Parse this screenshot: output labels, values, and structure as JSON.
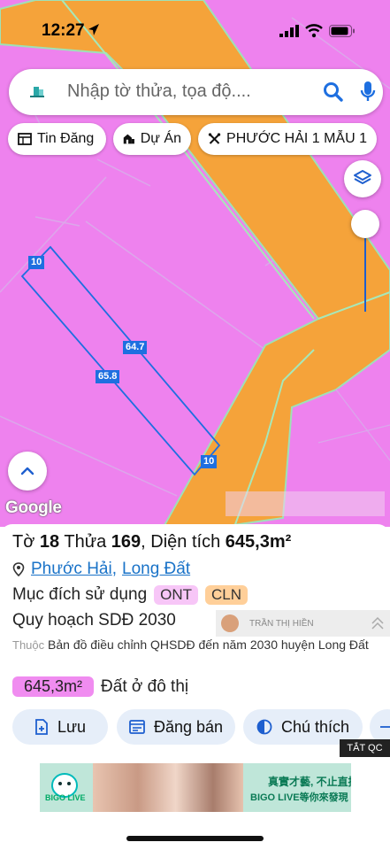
{
  "status_bar": {
    "time": "12:27"
  },
  "search": {
    "placeholder": "Nhập tờ thửa, tọa độ...."
  },
  "chips": [
    {
      "label": "Tin Đăng",
      "icon": "newspaper-icon"
    },
    {
      "label": "Dự Án",
      "icon": "buildings-icon"
    },
    {
      "label": "PHƯỚC HẢI 1 MẪU 1",
      "icon": "tools-icon"
    }
  ],
  "map": {
    "dimensions": {
      "top": "10",
      "bottom": "10",
      "right_long": "64.7",
      "left_long": "65.8"
    },
    "watermark": "Google"
  },
  "parcel": {
    "sheet_label": "Tờ",
    "sheet": "18",
    "plot_label": "Thửa",
    "plot": "169",
    "area_label": "Diện tích",
    "area": "645,3m²",
    "ward": "Phước Hải",
    "district": "Long Đất",
    "purpose_label": "Mục đích sử dụng",
    "purpose_tags": [
      "ONT",
      "CLN"
    ],
    "plan_label": "Quy hoạch SDĐ 2030",
    "desc_prefix": "Thuộc",
    "desc": "Bản đồ điều chỉnh QHSDĐ đến năm 2030 huyện Long Đất",
    "area_badge": "645,3m²",
    "land_type": "Đất ở đô thị"
  },
  "overlay": {
    "name": "TRẦN THỊ HIỀN"
  },
  "actions": [
    {
      "label": "Lưu",
      "icon": "save-doc-icon"
    },
    {
      "label": "Đăng bán",
      "icon": "listing-icon"
    },
    {
      "label": "Chú thích",
      "icon": "legend-icon"
    }
  ],
  "ad": {
    "close_label": "TẮT QC",
    "brand": "BIGO LIVE",
    "slogan_cn": "真實才藝, 不止直播",
    "slogan_sub": "BIGO LIVE等你來發現"
  },
  "colors": {
    "residential_pink": "#ee82ee",
    "road_orange": "#f5a33a",
    "parcel_blue": "#1e6fe0",
    "link_blue": "#1a73c8"
  }
}
